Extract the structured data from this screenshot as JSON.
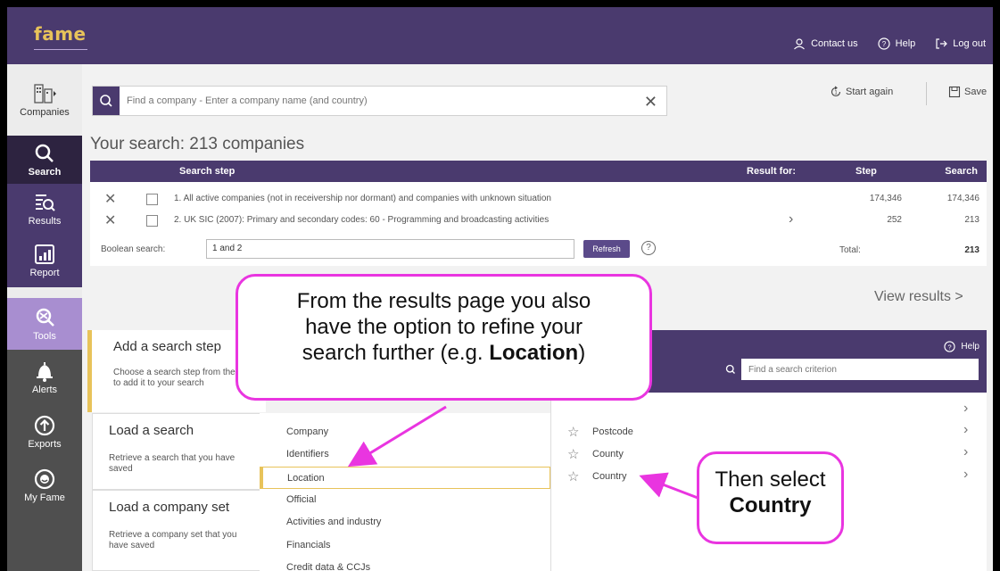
{
  "header": {
    "logo": "fame",
    "links": [
      {
        "label": "Contact us",
        "icon": "person-icon"
      },
      {
        "label": "Help",
        "icon": "help-circle-icon"
      },
      {
        "label": "Log out",
        "icon": "logout-icon"
      }
    ]
  },
  "sidebar": {
    "items": [
      {
        "label": "Companies",
        "icon": "building-icon"
      },
      {
        "label": "Search",
        "icon": "search-icon"
      },
      {
        "label": "Results",
        "icon": "results-list-icon"
      },
      {
        "label": "Report",
        "icon": "report-chart-icon"
      },
      {
        "label": "Tools",
        "icon": "tools-icon"
      },
      {
        "label": "Alerts",
        "icon": "bell-icon"
      },
      {
        "label": "Exports",
        "icon": "upload-icon"
      },
      {
        "label": "My Fame",
        "icon": "user-circle-icon"
      }
    ]
  },
  "search": {
    "placeholder": "Find a company - Enter a company name (and country)",
    "start_again": "Start again",
    "save": "Save"
  },
  "summary": {
    "title": "Your search: 213 companies"
  },
  "table": {
    "headers": {
      "step_label": "Search step",
      "result_for": "Result for:",
      "step": "Step",
      "search": "Search"
    },
    "rows": [
      {
        "text": "1. All active companies (not in receivership nor dormant) and companies with unknown situation",
        "step": "174,346",
        "search": "174,346"
      },
      {
        "text": "2. UK SIC (2007): Primary and secondary codes: 60 - Programming and broadcasting activities",
        "step": "252",
        "search": "213"
      }
    ],
    "boolean_label": "Boolean search:",
    "boolean_value": "1 and 2",
    "refresh": "Refresh",
    "help": "?",
    "total_label": "Total:",
    "total_value": "213"
  },
  "view_results": "View results >",
  "panels": {
    "add_step": {
      "title": "Add a search step",
      "desc": "Choose a search step from the list to add it to your search"
    },
    "load_search": {
      "title": "Load a search",
      "desc": "Retrieve a search that you have saved"
    },
    "load_set": {
      "title": "Load a company set",
      "desc": "Retrieve a company set that you have saved"
    }
  },
  "categories": [
    "Company",
    "Identifiers",
    "Location",
    "Official",
    "Activities and industry",
    "Financials",
    "Credit data & CCJs"
  ],
  "criteria_panel": {
    "help": "Help",
    "placeholder": "Find a search criterion",
    "items": [
      "Postcode",
      "County",
      "Country"
    ]
  },
  "callouts": {
    "main": {
      "line1": "From the results page you also",
      "line2": "have the option to refine your",
      "line3_a": "search further (e.g. ",
      "line3_b": "Location",
      "line3_c": ")"
    },
    "second": {
      "line1": "Then select",
      "line2": "Country"
    }
  },
  "colors": {
    "brand_purple": "#4a3a6e",
    "accent_gold": "#e8c35a",
    "callout_magenta": "#e935e0"
  }
}
